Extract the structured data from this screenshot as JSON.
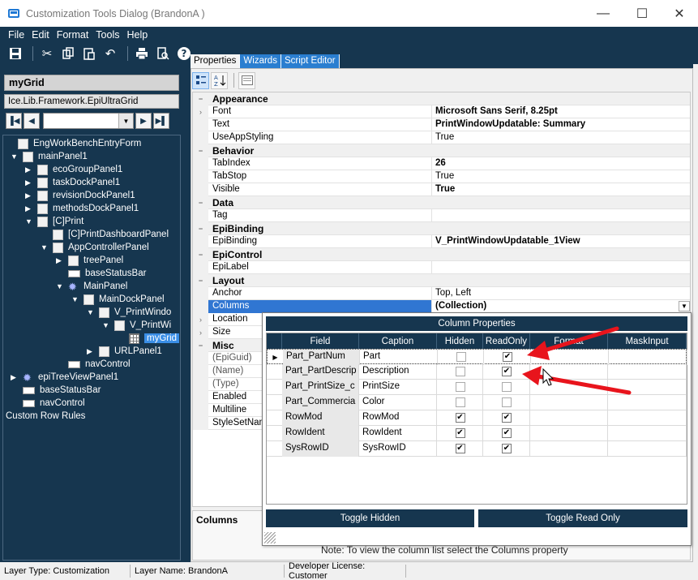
{
  "window": {
    "title": "Customization Tools Dialog  (BrandonA )",
    "minimize": "—",
    "maximize": "☐",
    "close": "✕"
  },
  "menu": [
    "File",
    "Edit",
    "Format",
    "Tools",
    "Help"
  ],
  "toolbar_icons": [
    "save-icon",
    "cut-icon",
    "copy-icon",
    "paste-icon",
    "undo-icon",
    "print-icon",
    "print-preview-icon",
    "help-icon"
  ],
  "left": {
    "object_name": "myGrid",
    "object_type": "Ice.Lib.Framework.EpiUltraGrid",
    "tree": [
      {
        "label": "EngWorkBenchEntryForm",
        "exp": "",
        "icon": "form"
      },
      {
        "label": "mainPanel1",
        "exp": "▼",
        "icon": "panel"
      },
      {
        "label": "ecoGroupPanel1",
        "exp": "▶",
        "icon": "panel"
      },
      {
        "label": "taskDockPanel1",
        "exp": "▶",
        "icon": "panel"
      },
      {
        "label": "revisionDockPanel1",
        "exp": "▶",
        "icon": "panel"
      },
      {
        "label": "methodsDockPanel1",
        "exp": "▶",
        "icon": "panel"
      },
      {
        "label": "[C]Print",
        "exp": "▼",
        "icon": "panel"
      },
      {
        "label": "[C]PrintDashboardPanel",
        "exp": "",
        "icon": "panel"
      },
      {
        "label": "AppControllerPanel",
        "exp": "▼",
        "icon": "panel"
      },
      {
        "label": "treePanel",
        "exp": "▶",
        "icon": "panel"
      },
      {
        "label": "baseStatusBar",
        "exp": "",
        "icon": "bar"
      },
      {
        "label": "MainPanel",
        "exp": "▼",
        "icon": "gear"
      },
      {
        "label": "MainDockPanel",
        "exp": "▼",
        "icon": "panel"
      },
      {
        "label": "V_PrintWindo",
        "exp": "▼",
        "icon": "panel"
      },
      {
        "label": "V_PrintWi",
        "exp": "▼",
        "icon": "panel"
      },
      {
        "label": "myGrid",
        "exp": "",
        "icon": "grid"
      },
      {
        "label": "URLPanel1",
        "exp": "▶",
        "icon": "panel"
      },
      {
        "label": "navControl",
        "exp": "",
        "icon": "bar"
      },
      {
        "label": "epiTreeViewPanel1",
        "exp": "▶",
        "icon": "gear"
      },
      {
        "label": "baseStatusBar",
        "exp": "",
        "icon": "bar"
      },
      {
        "label": "navControl",
        "exp": "",
        "icon": "bar"
      },
      {
        "label": "Custom Row Rules",
        "exp": "",
        "icon": "none"
      }
    ]
  },
  "tabs": [
    "Properties",
    "Wizards",
    "Script Editor"
  ],
  "properties": [
    {
      "cat": true,
      "name": "Appearance"
    },
    {
      "name": "Font",
      "value": "Microsoft Sans Serif, 8.25pt",
      "bold": true,
      "gut": "›"
    },
    {
      "name": "Text",
      "value": "PrintWindowUpdatable: Summary",
      "bold": true
    },
    {
      "name": "UseAppStyling",
      "value": "True"
    },
    {
      "cat": true,
      "name": "Behavior"
    },
    {
      "name": "TabIndex",
      "value": "26",
      "bold": true
    },
    {
      "name": "TabStop",
      "value": "True"
    },
    {
      "name": "Visible",
      "value": "True",
      "bold": true
    },
    {
      "cat": true,
      "name": "Data"
    },
    {
      "name": "Tag",
      "value": ""
    },
    {
      "cat": true,
      "name": "EpiBinding"
    },
    {
      "name": "EpiBinding",
      "value": "V_PrintWindowUpdatable_1View",
      "bold": true
    },
    {
      "cat": true,
      "name": "EpiControl"
    },
    {
      "name": "EpiLabel",
      "value": ""
    },
    {
      "cat": true,
      "name": "Layout"
    },
    {
      "name": "Anchor",
      "value": "Top, Left"
    },
    {
      "name": "Columns",
      "value": "(Collection)",
      "bold": true,
      "sel": true
    },
    {
      "name": "Location",
      "value": "",
      "gut": "›"
    },
    {
      "name": "Size",
      "value": "",
      "gut": "›"
    },
    {
      "cat": true,
      "name": "Misc"
    },
    {
      "name": "(EpiGuid)",
      "value": "",
      "dim": true
    },
    {
      "name": "(Name)",
      "value": "",
      "dim": true
    },
    {
      "name": "(Type)",
      "value": "",
      "dim": true
    },
    {
      "name": "Enabled",
      "value": ""
    },
    {
      "name": "Multiline",
      "value": ""
    },
    {
      "name": "StyleSetName",
      "value": ""
    }
  ],
  "description": {
    "title": "Columns",
    "note": "Note:  To view the column list select the Columns property"
  },
  "popup": {
    "title": "Column Properties",
    "headers": [
      "Field",
      "Caption",
      "Hidden",
      "ReadOnly",
      "Format",
      "MaskInput"
    ],
    "rows": [
      {
        "field": "Part_PartNum",
        "caption": "Part",
        "hidden": false,
        "readonly": true
      },
      {
        "field": "Part_PartDescrip",
        "caption": "Description",
        "hidden": false,
        "readonly": true
      },
      {
        "field": "Part_PrintSize_c",
        "caption": "PrintSize",
        "hidden": false,
        "readonly": false
      },
      {
        "field": "Part_Commercia",
        "caption": "Color",
        "hidden": false,
        "readonly": false
      },
      {
        "field": "RowMod",
        "caption": "RowMod",
        "hidden": true,
        "readonly": true
      },
      {
        "field": "RowIdent",
        "caption": "RowIdent",
        "hidden": true,
        "readonly": true
      },
      {
        "field": "SysRowID",
        "caption": "SysRowID",
        "hidden": true,
        "readonly": true
      }
    ],
    "toggle_hidden": "Toggle Hidden",
    "toggle_readonly": "Toggle Read Only"
  },
  "status": {
    "layer_type": "Layer Type:  Customization",
    "layer_name": "Layer Name:  BrandonA",
    "license": "Developer License:  Customer"
  },
  "colors": {
    "dark_navy": "#16364f",
    "accent_blue": "#2a7ed0",
    "arrow_red": "#e8141c"
  }
}
